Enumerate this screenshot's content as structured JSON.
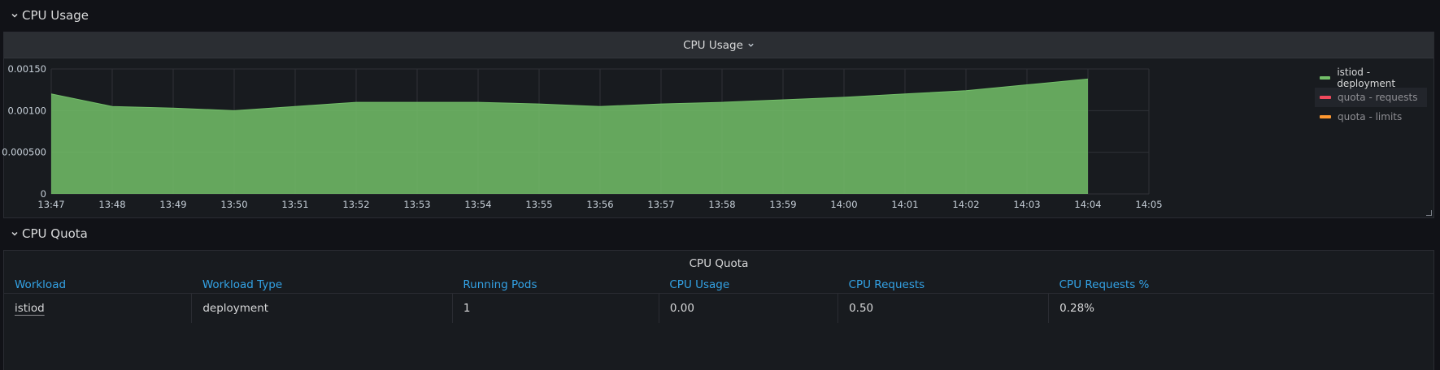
{
  "rows": {
    "cpu_usage": {
      "label": "CPU Usage"
    },
    "cpu_quota": {
      "label": "CPU Quota"
    }
  },
  "cpu_panel": {
    "title": "CPU Usage",
    "legend": [
      {
        "label": "istiod - deployment",
        "color": "#73bf69",
        "hidden": false
      },
      {
        "label": "quota - requests",
        "color": "#f2495c",
        "hidden": true
      },
      {
        "label": "quota - limits",
        "color": "#ff9830",
        "hidden": true
      }
    ]
  },
  "chart_data": {
    "type": "area",
    "title": "CPU Usage",
    "x": [
      "13:47",
      "13:48",
      "13:49",
      "13:50",
      "13:51",
      "13:52",
      "13:53",
      "13:54",
      "13:55",
      "13:56",
      "13:57",
      "13:58",
      "13:59",
      "14:00",
      "14:01",
      "14:02",
      "14:03",
      "14:04"
    ],
    "x_ticks": [
      "13:47",
      "13:48",
      "13:49",
      "13:50",
      "13:51",
      "13:52",
      "13:53",
      "13:54",
      "13:55",
      "13:56",
      "13:57",
      "13:58",
      "13:59",
      "14:00",
      "14:01",
      "14:02",
      "14:03",
      "14:04",
      "14:05"
    ],
    "y_ticks": [
      "0",
      "0.000500",
      "0.00100",
      "0.00150"
    ],
    "ylim": [
      0,
      0.0015
    ],
    "grid": true,
    "legend_position": "right",
    "series": [
      {
        "name": "istiod - deployment",
        "color": "#73bf69",
        "values": [
          0.0012,
          0.00105,
          0.00103,
          0.001,
          0.00105,
          0.0011,
          0.0011,
          0.0011,
          0.00108,
          0.00105,
          0.00108,
          0.0011,
          0.00113,
          0.00116,
          0.0012,
          0.00124,
          0.00131,
          0.00138
        ]
      }
    ]
  },
  "quota_panel": {
    "title": "CPU Quota",
    "columns": [
      "Workload",
      "Workload Type",
      "Running Pods",
      "CPU Usage",
      "CPU Requests",
      "CPU Requests %"
    ],
    "rows": [
      [
        "istiod",
        "deployment",
        "1",
        "0.00",
        "0.50",
        "0.28%"
      ]
    ]
  }
}
